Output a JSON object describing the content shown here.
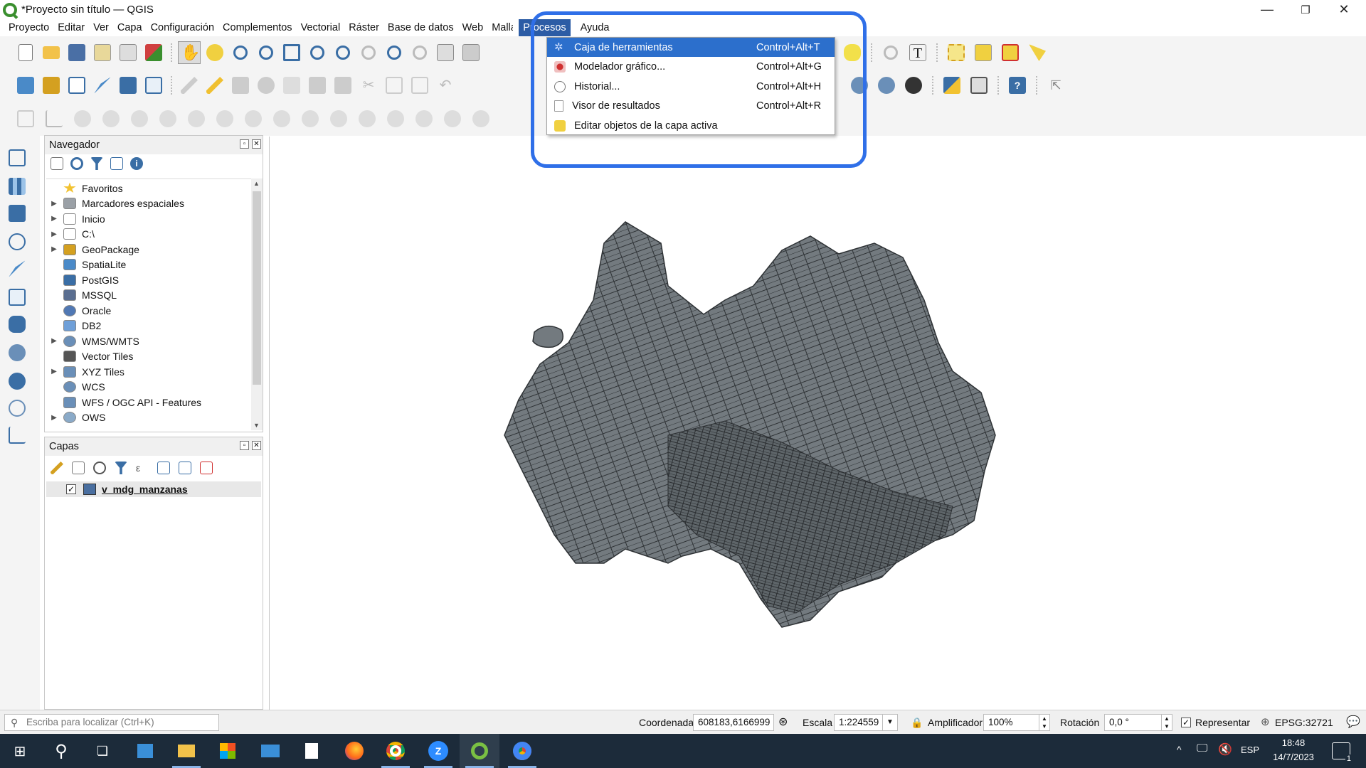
{
  "window": {
    "title": "*Proyecto sin título — QGIS",
    "minimize_icon": "minimize-icon",
    "restore_icon": "restore-icon",
    "close_icon": "close-icon"
  },
  "menubar": {
    "items": [
      {
        "label": "Proyecto",
        "underline": "P"
      },
      {
        "label": "Editar",
        "underline": "E"
      },
      {
        "label": "Ver",
        "underline": "V"
      },
      {
        "label": "Capa",
        "underline": "C"
      },
      {
        "label": "Configuración",
        "underline": "o"
      },
      {
        "label": "Complementos",
        "underline": "o"
      },
      {
        "label": "Vectorial",
        "underline": "o"
      },
      {
        "label": "Ráster",
        "underline": "R"
      },
      {
        "label": "Base de datos",
        "underline": "d"
      },
      {
        "label": "Web",
        "underline": "W"
      },
      {
        "label": "Malla",
        "underline": "M"
      },
      {
        "label": "Procesos",
        "underline": "s",
        "active": true
      },
      {
        "label": "Ayuda",
        "underline": "A"
      }
    ]
  },
  "procesos_menu": {
    "items": [
      {
        "label": "Caja de herramientas",
        "shortcut": "Control+Alt+T",
        "icon": "gear-icon",
        "highlighted": true
      },
      {
        "label": "Modelador gráfico...",
        "shortcut": "Control+Alt+G",
        "icon": "model-icon"
      },
      {
        "label": "Historial...",
        "shortcut": "Control+Alt+H",
        "icon": "clock-icon"
      },
      {
        "label": "Visor de resultados",
        "shortcut": "Control+Alt+R",
        "icon": "document-icon"
      },
      {
        "label": "Editar objetos de la capa activa",
        "shortcut": "",
        "icon": "edit-features-icon"
      }
    ]
  },
  "navigator": {
    "title": "Navegador",
    "items": [
      {
        "label": "Favoritos",
        "icon": "star-icon",
        "expandable": false,
        "color": "#f2c230"
      },
      {
        "label": "Marcadores espaciales",
        "icon": "bookmark-icon",
        "expandable": true,
        "color": "#9aa0a6"
      },
      {
        "label": "Inicio",
        "icon": "home-icon",
        "expandable": true,
        "color": "#ffffff"
      },
      {
        "label": "C:\\",
        "icon": "folder-icon",
        "expandable": true,
        "color": "#ffffff"
      },
      {
        "label": "GeoPackage",
        "icon": "geopackage-icon",
        "expandable": true,
        "color": "#d4a020"
      },
      {
        "label": "SpatiaLite",
        "icon": "feather-icon",
        "expandable": false,
        "color": "#4a8ac8"
      },
      {
        "label": "PostGIS",
        "icon": "elephant-icon",
        "expandable": false,
        "color": "#3a6ea5"
      },
      {
        "label": "MSSQL",
        "icon": "mssql-icon",
        "expandable": false,
        "color": "#5a6e90"
      },
      {
        "label": "Oracle",
        "icon": "oracle-icon",
        "expandable": false,
        "color": "#5078b4"
      },
      {
        "label": "DB2",
        "icon": "db2-icon",
        "expandable": false,
        "color": "#6e9fd8"
      },
      {
        "label": "WMS/WMTS",
        "icon": "globe-icon",
        "expandable": true,
        "color": "#6a8fb8"
      },
      {
        "label": "Vector Tiles",
        "icon": "grid-icon",
        "expandable": false,
        "color": "#555555"
      },
      {
        "label": "XYZ Tiles",
        "icon": "tiles-icon",
        "expandable": true,
        "color": "#6a8fb8"
      },
      {
        "label": "WCS",
        "icon": "globe-icon",
        "expandable": false,
        "color": "#6a8fb8"
      },
      {
        "label": "WFS / OGC API - Features",
        "icon": "wfs-icon",
        "expandable": false,
        "color": "#6a8fb8"
      },
      {
        "label": "OWS",
        "icon": "globe-icon",
        "expandable": true,
        "color": "#8aaac8"
      }
    ]
  },
  "layers": {
    "title": "Capas",
    "items": [
      {
        "label": "v_mdg_manzanas",
        "checked": true,
        "color": "#4a6fa0"
      }
    ]
  },
  "statusbar": {
    "locator_placeholder": "Escriba para localizar (Ctrl+K)",
    "coordinate_label": "Coordenada",
    "coordinate_value": "608183,6166999",
    "scale_label": "Escala",
    "scale_value": "1:224559",
    "magnifier_label": "Amplificador",
    "magnifier_value": "100%",
    "rotation_label": "Rotación",
    "rotation_value": "0,0 °",
    "render_label": "Representar",
    "render_checked": true,
    "crs": "EPSG:32721"
  },
  "taskbar": {
    "language": "ESP",
    "time": "18:48",
    "date": "14/7/2023",
    "notifications": "1"
  },
  "colors": {
    "accent": "#2c6fcc",
    "highlight_ring": "#2f6fe8",
    "map_fill": "#737a7f",
    "map_stroke": "#2e3235",
    "taskbar": "#1c2b3a"
  }
}
